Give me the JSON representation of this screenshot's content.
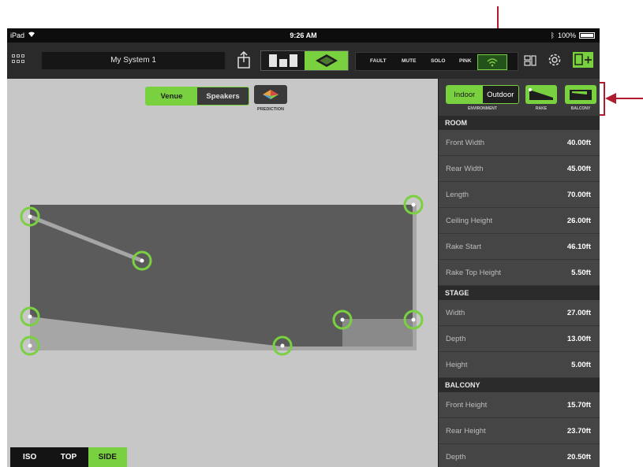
{
  "status_bar": {
    "device": "iPad",
    "time": "9:26 AM",
    "battery": "100%"
  },
  "toolbar": {
    "system_name": "My System 1",
    "buses": [
      "FAULT",
      "MUTE",
      "SOLO",
      "PINK"
    ]
  },
  "canvas": {
    "mode_tabs": [
      {
        "label": "Venue",
        "active": true
      },
      {
        "label": "Speakers",
        "active": false
      }
    ],
    "prediction_label": "PREDICTION",
    "view_tabs": [
      {
        "label": "ISO",
        "active": false
      },
      {
        "label": "TOP",
        "active": false
      },
      {
        "label": "SIDE",
        "active": true
      }
    ]
  },
  "panel": {
    "environment": {
      "options": [
        "Indoor",
        "Outdoor"
      ],
      "selected": "Indoor",
      "label": "ENVIRONMENT"
    },
    "rake_label": "RAKE",
    "balcony_label": "BALCONY",
    "sections": [
      {
        "title": "ROOM",
        "rows": [
          {
            "label": "Front Width",
            "value": "40.00ft"
          },
          {
            "label": "Rear Width",
            "value": "45.00ft"
          },
          {
            "label": "Length",
            "value": "70.00ft"
          },
          {
            "label": "Ceiling Height",
            "value": "26.00ft"
          },
          {
            "label": "Rake Start",
            "value": "46.10ft"
          },
          {
            "label": "Rake Top Height",
            "value": "5.50ft"
          }
        ]
      },
      {
        "title": "STAGE",
        "rows": [
          {
            "label": "Width",
            "value": "27.00ft"
          },
          {
            "label": "Depth",
            "value": "13.00ft"
          },
          {
            "label": "Height",
            "value": "5.00ft"
          }
        ]
      },
      {
        "title": "BALCONY",
        "rows": [
          {
            "label": "Front Height",
            "value": "15.70ft"
          },
          {
            "label": "Rear Height",
            "value": "23.70ft"
          },
          {
            "label": "Depth",
            "value": "20.50ft"
          }
        ]
      }
    ]
  },
  "colors": {
    "accent": "#7ad13f",
    "annotation": "#b01c2e",
    "panel_bg": "#3a3a3a",
    "toolbar_bg": "#2a2a2a"
  }
}
